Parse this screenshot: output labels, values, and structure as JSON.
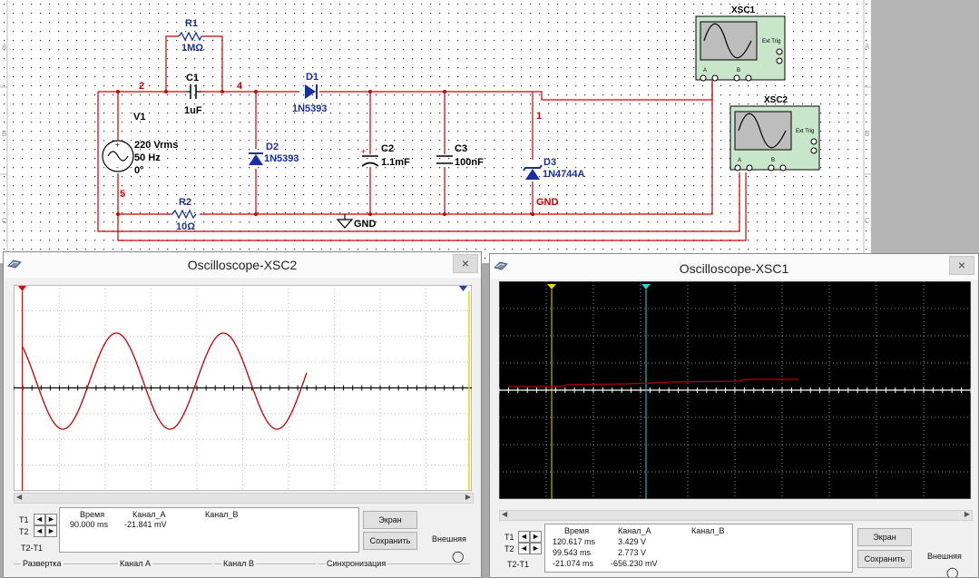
{
  "schematic": {
    "nodes": {
      "n2": "2",
      "n4": "4",
      "n1": "1",
      "n5": "5"
    },
    "r1": {
      "ref": "R1",
      "value": "1MΩ"
    },
    "c1": {
      "ref": "C1",
      "value": "1uF"
    },
    "d1": {
      "ref": "D1",
      "part": "1N5393"
    },
    "d2": {
      "ref": "D2",
      "part": "1N5393"
    },
    "d3": {
      "ref": "D3",
      "part": "1N4744A"
    },
    "c2": {
      "ref": "C2",
      "value": "1.1mF",
      "polarity": "+"
    },
    "c3": {
      "ref": "C3",
      "value": "100nF"
    },
    "r2": {
      "ref": "R2",
      "value": "10Ω"
    },
    "v1": {
      "ref": "V1",
      "voltage": "220 Vrms",
      "freq": "50 Hz",
      "phase": "0°"
    },
    "gnd_label": "GND",
    "gnd_net_label": "GND",
    "xsc1": {
      "ref": "XSC1",
      "ext_trig": "Ext Trig",
      "ch_a": "A",
      "ch_b": "B"
    },
    "xsc2": {
      "ref": "XSC2",
      "ext_trig": "Ext Trig",
      "ch_a": "A",
      "ch_b": "B"
    },
    "row_labels": [
      "A",
      "B",
      "C"
    ],
    "colors": {
      "wire": "#cc0000",
      "component": "#1a2f9a",
      "label": "#000000"
    }
  },
  "osc2": {
    "title": "Oscilloscope-XSC2",
    "close": "×",
    "trace_color": "#c00000",
    "t1": "T1",
    "t2": "T2",
    "t2t1": "T2-T1",
    "col_time": "Время",
    "col_a": "Канал_A",
    "col_b": "Канал_B",
    "row1_time": "90.000 ms",
    "row1_a": "-21.841 mV",
    "btn_screen": "Экран",
    "btn_save": "Сохранить",
    "ext": "Внешняя",
    "group_sweep": "Развертка",
    "group_cha": "Канал A",
    "group_chb": "Канал B",
    "group_sync": "Синхронизация"
  },
  "osc1": {
    "title": "Oscilloscope-XSC1",
    "close": "×",
    "trace_color": "#b00000",
    "t1": "T1",
    "t2": "T2",
    "t2t1": "T2-T1",
    "col_time": "Время",
    "col_a": "Канал_A",
    "col_b": "Канал_B",
    "row1_time": "120.617 ms",
    "row1_a": "3.429 V",
    "row2_time": "99.543 ms",
    "row2_a": "2.773 V",
    "row3_time": "-21.074 ms",
    "row3_a": "-656.230 mV",
    "btn_screen": "Экран",
    "btn_save": "Сохранить",
    "ext": "Внешняя"
  }
}
